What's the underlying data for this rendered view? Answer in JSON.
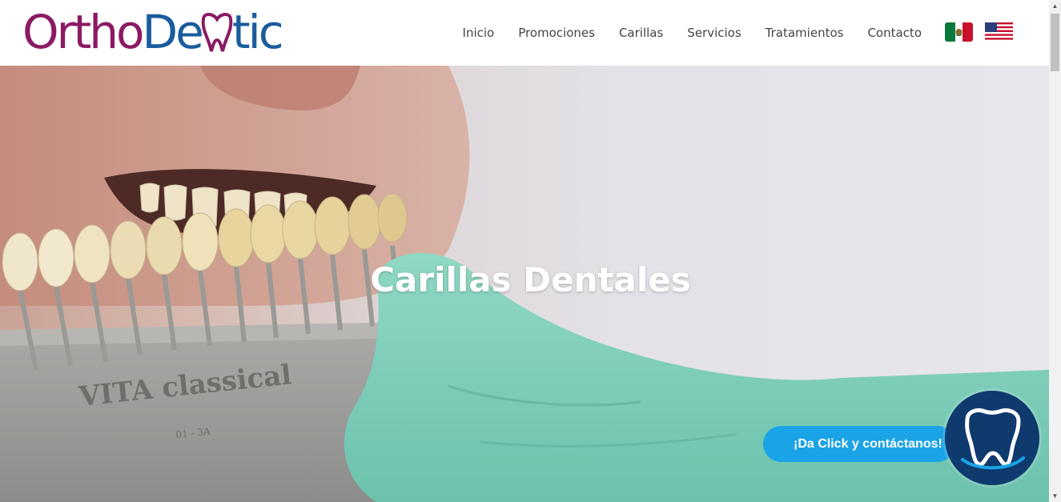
{
  "brand": {
    "part1": "Ortho",
    "part2_a": "De",
    "part2_b": "tic",
    "colors": {
      "primary": "#8a1a63",
      "secondary": "#1a5c9c"
    }
  },
  "nav": {
    "items": [
      "Inicio",
      "Promociones",
      "Carillas",
      "Servicios",
      "Tratamientos",
      "Contacto"
    ]
  },
  "languages": {
    "flags": [
      "mexico-flag-icon",
      "usa-flag-icon"
    ]
  },
  "hero": {
    "title": "Carillas Dentales",
    "shade_guide_text_1": "VITA classical",
    "shade_guide_text_2": "01 - 3A"
  },
  "cta": {
    "label": "¡Da Click y contáctanos!",
    "color": "#1aa3e6",
    "badge_color": "#0e3a6e"
  }
}
